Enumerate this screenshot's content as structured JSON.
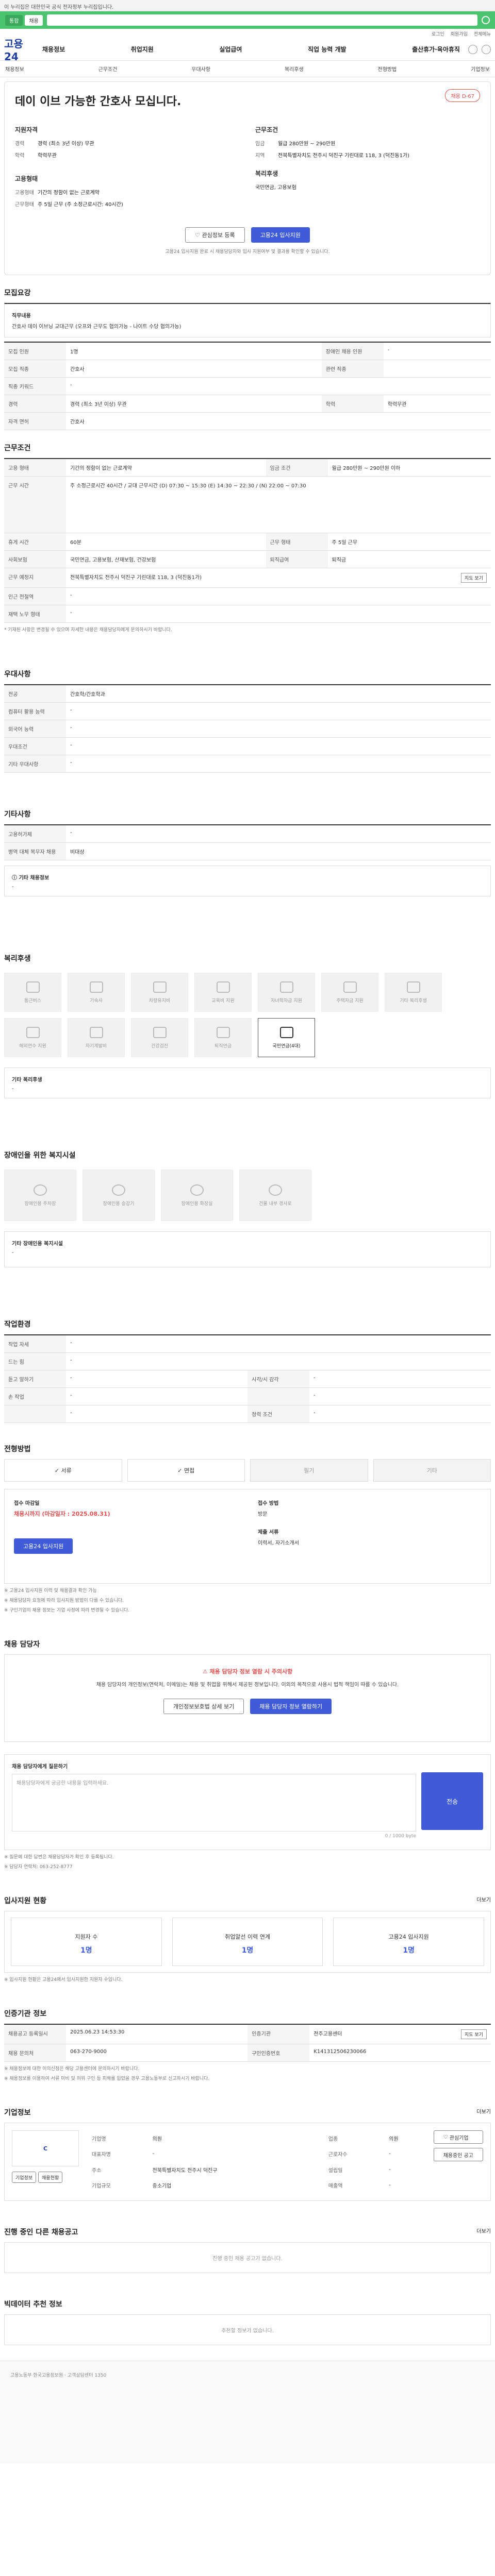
{
  "gov_banner": "이 누리집은 대한민국 공식 전자정부 누리집입니다.",
  "search_tabs": [
    "통합",
    "채용"
  ],
  "utility": [
    "로그인",
    "회원가입",
    "전체메뉴"
  ],
  "logo": "고용24",
  "gnb": [
    "채용정보",
    "취업지원",
    "실업급여",
    "직업 능력 개발",
    "출산휴가·육아휴직"
  ],
  "subnav": [
    "채용정보",
    "근무조건",
    "우대사항",
    "복리후생",
    "전형방법",
    "기업정보"
  ],
  "summary": {
    "badge": "채용 D-67",
    "title": "데이 이브 가능한 간호사 모십니다.",
    "req_title": "지원자격",
    "req": [
      {
        "k": "경력",
        "v": "경력 (최소 3년 이상) 무관"
      },
      {
        "k": "학력",
        "v": "학력무관"
      }
    ],
    "work_title": "근무조건",
    "work": [
      {
        "k": "임금",
        "v": "월급 280만원 ~ 290만원"
      },
      {
        "k": "지역",
        "v": "전북특별자치도 전주시 덕진구 기린대로 118, 3 (덕진동1가)"
      }
    ],
    "type_title": "고용형태",
    "type": [
      {
        "k": "고용형태",
        "v": "기간의 정함이 없는 근로계약"
      },
      {
        "k": "근무형태",
        "v": "주 5일 근무 (주 소정근로시간: 40시간)"
      }
    ],
    "welfare_title": "복리후생",
    "welfare": "국민연금, 고용보험",
    "btn_interest": "관심정보 등록",
    "btn_apply": "고용24 입사지원",
    "note": "고용24 입사지원 완료 시 채용담당자와 입사 지원여부 및 결과를 확인할 수 있습니다."
  },
  "recruit": {
    "title": "모집요강",
    "duty_label": "직무내용",
    "duty": "간호사 데이 이브닝 교대근무 (오프와 근무도 협의가능 - 나이트 수당 협의가능)",
    "rows": [
      {
        "k": "모집 직종",
        "v": "간호사",
        "k2": "관련 직종",
        "v2": ""
      },
      {
        "k": "모집 인원",
        "v": "1명",
        "k2": "장애인 채용 인원",
        "v2": "-"
      },
      {
        "k": "직종 키워드",
        "v": "-",
        "k2": "",
        "v2": ""
      },
      {
        "k": "경력",
        "v": "경력 (최소 3년 이상) 무관",
        "k2": "학력",
        "v2": "학력무관"
      },
      {
        "k": "자격 면허",
        "v": "간호사",
        "k2": "",
        "v2": ""
      }
    ]
  },
  "conditions": {
    "title": "근무조건",
    "rows": [
      {
        "k": "고용 형태",
        "v": "기간의 정함이 없는 근로계약",
        "k2": "임금 조건",
        "v2": "월급 280만원 ~ 290만원 이하"
      },
      {
        "k": "근무 시간",
        "v": "주 소정근로시간 40시간 / 교대 근무시간 (D) 07:30 ~ 15:30 (E) 14:30 ~ 22:30 / (N) 22:00 ~ 07:30",
        "k2": "",
        "v2": ""
      },
      {
        "k": "휴게 시간",
        "v": "60분",
        "k2": "근무 형태",
        "v2": "주 5일 근무"
      },
      {
        "k": "사회보험",
        "v": "국민연금, 고용보험, 산재보험, 건강보험",
        "k2": "퇴직급여",
        "v2": "퇴직금"
      },
      {
        "k": "근무 예정지",
        "v": "전북특별자치도 전주시 덕진구 기린대로 118, 3 (덕진동1가)",
        "k2": "",
        "v2": ""
      },
      {
        "k": "인근 전철역",
        "v": "-",
        "k2": "",
        "v2": ""
      },
      {
        "k": "재택 노무 형태",
        "v": "-",
        "k2": "",
        "v2": ""
      }
    ],
    "map_btn": "지도 보기",
    "note": "* 기재된 사항은 변경될 수 있으며 자세한 내용은 채용담당자에게 문의하시기 바랍니다."
  },
  "prefer": {
    "title": "우대사항",
    "rows": [
      {
        "k": "전공",
        "v": "간호학/간호학과"
      },
      {
        "k": "컴퓨터 활용 능력",
        "v": "-"
      },
      {
        "k": "외국어 능력",
        "v": "-"
      },
      {
        "k": "우대조건",
        "v": "-"
      },
      {
        "k": "기타 우대사항",
        "v": "-"
      }
    ]
  },
  "other": {
    "title": "기타사항",
    "rows": [
      {
        "k": "고용허가제",
        "v": "-"
      },
      {
        "k": "병역 대체 복무자 채용",
        "v": "비대상"
      }
    ],
    "extra_title": "기타 채용정보",
    "extra": "-"
  },
  "welfare": {
    "title": "복리후생",
    "items": [
      {
        "label": "통근버스",
        "on": false
      },
      {
        "label": "기숙사",
        "on": false
      },
      {
        "label": "차량유지비",
        "on": false
      },
      {
        "label": "교육비 지원",
        "on": false
      },
      {
        "label": "자녀학자금 지원",
        "on": false
      },
      {
        "label": "주택자금 지원",
        "on": false
      },
      {
        "label": "기타 복리후생",
        "on": false
      },
      {
        "label": "해외연수 지원",
        "on": false
      },
      {
        "label": "자기계발비",
        "on": false
      },
      {
        "label": "건강검진",
        "on": false
      },
      {
        "label": "퇴직연금",
        "on": false
      },
      {
        "label": "국민연금(4대)",
        "on": true
      }
    ],
    "extra_title": "기타 복리후생",
    "extra": "-"
  },
  "disabled": {
    "title": "장애인을 위한 복지시설",
    "items": [
      "장애인용 주차장",
      "장애인용 승강기",
      "장애인용 화장실",
      "건물 내부 경사로"
    ],
    "extra_title": "기타 장애인용 복지시설",
    "extra": "-"
  },
  "env": {
    "title": "작업환경",
    "rows": [
      {
        "k": "작업 자세",
        "v": "-",
        "k2": "",
        "v2": ""
      },
      {
        "k": "드는 힘",
        "v": "-",
        "k2": "",
        "v2": ""
      },
      {
        "k": "듣고 말하기",
        "v": "-",
        "k2": "시각/시 감각",
        "v2": "-"
      },
      {
        "k": "손 작업",
        "v": "-",
        "k2": "",
        "v2": "-"
      },
      {
        "k": "",
        "v": "-",
        "k2": "청력 조건",
        "v2": "-"
      }
    ]
  },
  "screening": {
    "title": "전형방법",
    "methods": [
      {
        "label": "서류",
        "on": true
      },
      {
        "label": "면접",
        "on": true
      },
      {
        "label": "필기",
        "on": false
      },
      {
        "label": "기타",
        "on": false
      }
    ],
    "deadline_label": "접수 마감일",
    "deadline": "채용시까지 (마감일자 : 2025.08.31)",
    "method_label": "접수 방법",
    "method": "방문",
    "docs_label": "제출 서류",
    "docs": "이력서, 자기소개서",
    "apply_btn": "고용24 입사지원",
    "notes": [
      "※ 고용24 입사지원 이력 및 채용결과 확인 가능",
      "※ 채용담당자 요청에 따라 입사지원 방법이 다를 수 있습니다.",
      "※ 구인기업의 채용 정보는 기업 사정에 따라 변경될 수 있습니다."
    ]
  },
  "contact": {
    "title": "채용 담당자",
    "warn_title": "채용 담당자 정보 열람 시 주의사항",
    "warn_text": "채용 담당자의 개인정보(연락처, 이메일)는 채용 및 취업을 위해서 제공된 정보입니다. 이외의 목적으로 사용시 법적 책임이 따를 수 있습니다.",
    "btn_agree": "개인정보보호법 상세 보기",
    "btn_view": "채용 담당자 정보 열람하기"
  },
  "inquiry": {
    "title": "채용 담당자에게 질문하기",
    "hint": "0 / 1000 byte",
    "placeholder": "채용담당자에게 궁금한 내용을 입력하세요.",
    "send": "전송",
    "notes": [
      "※ 질문에 대한 답변은 채용담당자가 확인 후 등록됩니다.",
      "※ 담당자 연락처: 063-252-8777"
    ]
  },
  "status": {
    "title": "입사지원 현황",
    "more": "더보기",
    "stats": [
      {
        "label": "지원자 수",
        "value": "1명"
      },
      {
        "label": "취업알선 이력 연계",
        "value": "1명"
      },
      {
        "label": "고용24 입사지원",
        "value": "1명"
      }
    ],
    "note": "※ 입사지원 현황은 고용24에서 입사지원한 지원자 수입니다."
  },
  "info": {
    "title": "인증기관 정보",
    "rows": [
      {
        "k": "채용공고 등록일시",
        "v": "2025.06.23 14:53:30",
        "k2": "인증기관",
        "v2": "전주고용센터"
      },
      {
        "k": "채용 문의처",
        "v": "063-270-9000",
        "k2": "구인인증번호",
        "v2": "K141312506230066"
      }
    ],
    "notes": [
      "※ 채용정보에 대한 이의신청은 해당 고용센터에 문의하시기 바랍니다.",
      "※ 채용정보를 이용하여 서류 미비 및 허위 구인 등 피해를 입었을 경우 고용노동부로 신고하시기 바랍니다."
    ],
    "map_btn": "지도 보기"
  },
  "company": {
    "title": "기업정보",
    "more": "더보기",
    "logo": "C",
    "rows": [
      {
        "k": "기업명",
        "v": "의원",
        "k2": "업종",
        "v2": "의원"
      },
      {
        "k": "대표자명",
        "v": "-",
        "k2": "근로자수",
        "v2": "-"
      },
      {
        "k": "주소",
        "v": "전북특별자치도 전주시 덕진구",
        "k2": "설립일",
        "v2": "-"
      },
      {
        "k": "기업규모",
        "v": "중소기업",
        "k2": "매출액",
        "v2": "-"
      }
    ],
    "btn_interest": "관심기업",
    "btn_jobs": "채용중인 공고",
    "btn_small": [
      "기업정보",
      "채용현황"
    ]
  },
  "same_company": {
    "title": "진행 중인 다른 채용공고",
    "empty": "진행 중인 채용 공고가 없습니다.",
    "more": "더보기"
  },
  "recommend": {
    "title": "빅데이터 추천 정보",
    "empty": "추천할 정보가 없습니다."
  },
  "footer": "고용노동부 한국고용정보원 · 고객상담센터 1350"
}
